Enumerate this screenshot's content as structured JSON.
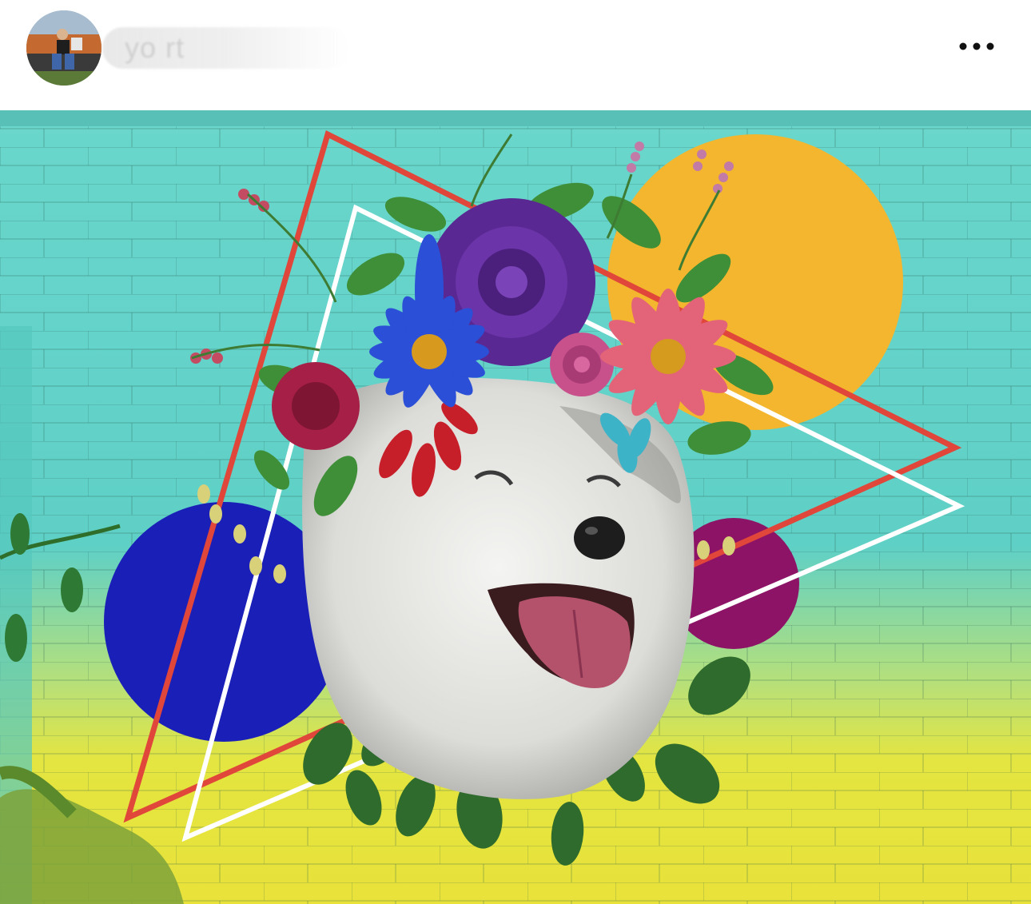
{
  "post": {
    "username": "yo        rt",
    "more_icon": "more-horizontal-icon",
    "avatar_icon": "profile-avatar"
  },
  "image": {
    "subject": "mural-dog-with-flower-crown",
    "colors": {
      "wall_top": "#5fd0c6",
      "wall_bottom": "#e6e63a",
      "yellow_circle": "#f3b62e",
      "blue_circle": "#1a1fb8",
      "purple_circle": "#8d1366",
      "red_line": "#e0463a",
      "white_line": "#ffffff"
    }
  }
}
